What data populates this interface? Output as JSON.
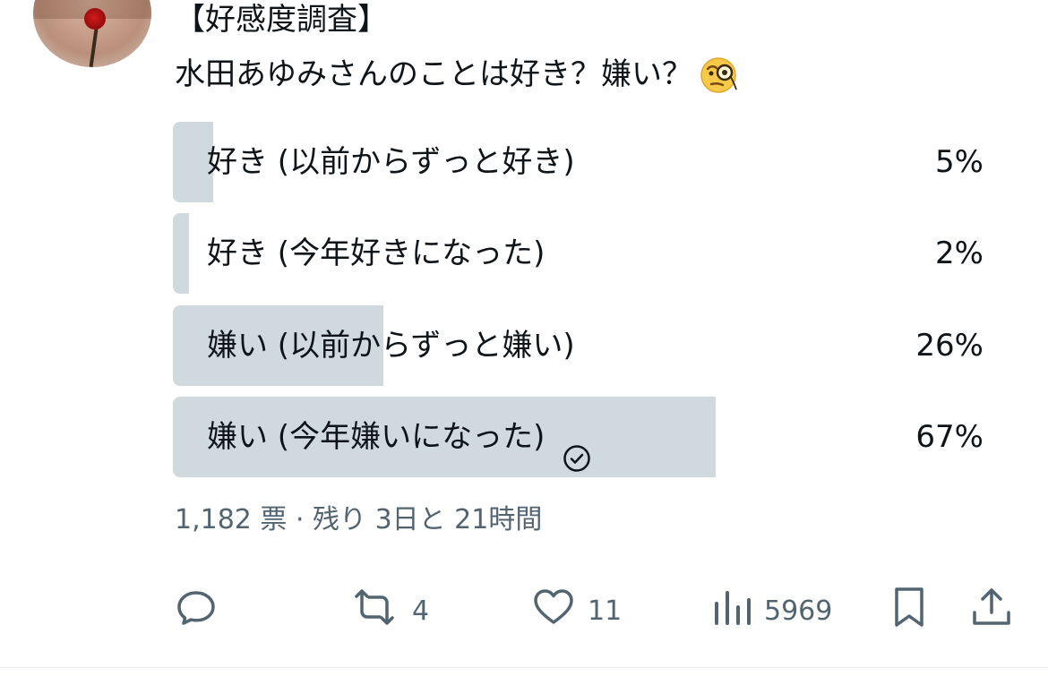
{
  "tweet": {
    "title": "【好感度調査】",
    "question": "水田あゆみさんのことは好き？嫌い？",
    "question_emoji": "face-with-monocle-icon"
  },
  "poll": {
    "options": [
      {
        "label": "好き (以前からずっと好き)",
        "percent_text": "5%",
        "percent": 5,
        "selected": false
      },
      {
        "label": "好き (今年好きになった)",
        "percent_text": "2%",
        "percent": 2,
        "selected": false
      },
      {
        "label": "嫌い (以前からずっと嫌い)",
        "percent_text": "26%",
        "percent": 26,
        "selected": false
      },
      {
        "label": "嫌い (今年嫌いになった)",
        "percent_text": "67%",
        "percent": 67,
        "selected": true
      }
    ],
    "meta": "1,182 票 · 残り 3日と 21時間"
  },
  "actions": {
    "reply": {
      "icon": "reply-icon",
      "count": ""
    },
    "retweet": {
      "icon": "retweet-icon",
      "count": "4"
    },
    "like": {
      "icon": "heart-icon",
      "count": "11"
    },
    "views": {
      "icon": "views-chart-icon",
      "count": "5969"
    },
    "bookmark": {
      "icon": "bookmark-icon"
    },
    "share": {
      "icon": "share-icon"
    }
  },
  "colors": {
    "text": "#0f1419",
    "muted": "#536471",
    "bar": "#cfd9de"
  }
}
